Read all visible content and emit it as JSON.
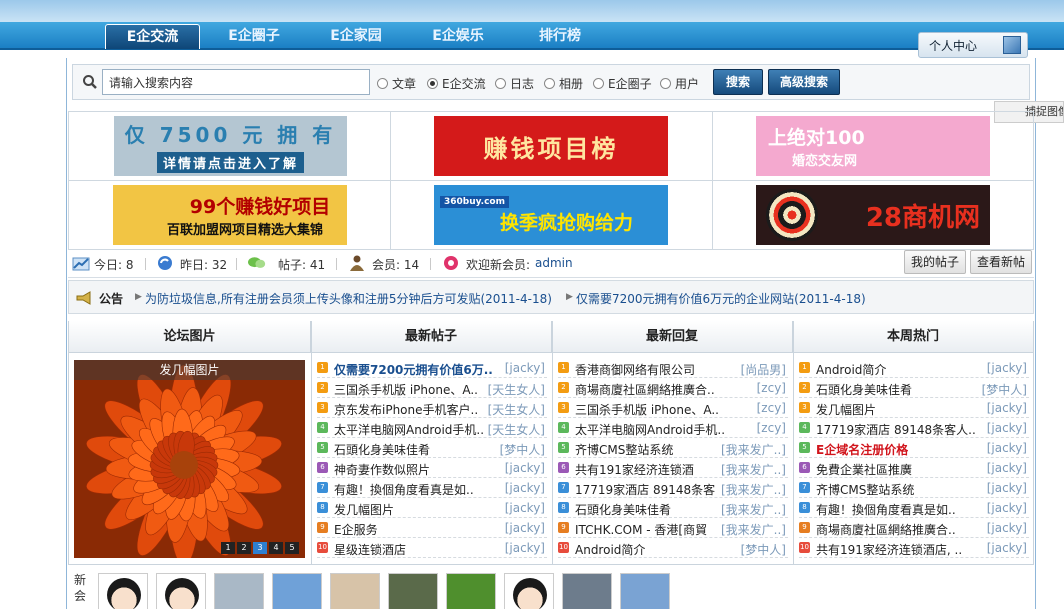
{
  "nav": {
    "tabs": [
      {
        "label": "E企交流",
        "active": true
      },
      {
        "label": "E企圈子",
        "active": false
      },
      {
        "label": "E企家园",
        "active": false
      },
      {
        "label": "E企娱乐",
        "active": false
      },
      {
        "label": "排行榜",
        "active": false
      }
    ],
    "user_center": "个人中心"
  },
  "search": {
    "placeholder": "请输入搜索内容",
    "value": "请输入搜索内容",
    "options": [
      {
        "label": "文章",
        "checked": false
      },
      {
        "label": "E企交流",
        "checked": true
      },
      {
        "label": "日志",
        "checked": false
      },
      {
        "label": "相册",
        "checked": false
      },
      {
        "label": "E企圈子",
        "checked": false
      },
      {
        "label": "用户",
        "checked": false
      }
    ],
    "search_button": "搜索",
    "advanced_button": "高级搜索"
  },
  "capture_popup": "捕捉图像",
  "ads": [
    {
      "line1": "仅 7500 元 拥 有",
      "line2": "详情请点击进入了解",
      "bg": "#b4c6d2",
      "fg": "#2a7fb0"
    },
    {
      "line1": "赚钱项目榜",
      "line2": "",
      "bg": "#d41a1a",
      "fg": "#ffe6a0"
    },
    {
      "line1": "上绝对100",
      "line2": "婚恋交友网",
      "bg": "#f4a9cf",
      "fg": "#fff"
    },
    {
      "line1": "99个赚钱好项目",
      "line2": "百联加盟网项目精选大集锦",
      "bg": "#f2c544",
      "fg": "#b30000"
    },
    {
      "line1": "换季疯抢购给力",
      "line2": "360buy.com",
      "bg": "#2b8fd6",
      "fg": "#ffef3c"
    },
    {
      "line1": "28商机网",
      "line2": "",
      "bg": "#2b1818",
      "fg": "#e8301f"
    }
  ],
  "stats": {
    "today": "今日: 8",
    "yesterday": "昨日: 32",
    "posts": "帖子: 41",
    "members": "会员: 14",
    "welcome": "欢迎新会员:",
    "new_member": "admin",
    "my_posts": "我的帖子",
    "view_new": "查看新帖"
  },
  "notice": {
    "label": "公告",
    "items": [
      "为防垃圾信息,所有注册会员须上传头像和注册5分钟后方可发贴(2011-4-18)",
      "仅需要7200元拥有价值6万元的企业网站(2011-4-18)"
    ]
  },
  "columns": {
    "pics": "论坛图片",
    "latest_posts": "最新帖子",
    "latest_replies": "最新回复",
    "weekly_hot": "本周热门"
  },
  "pic_caption": "发几幅图片",
  "pic_pages": [
    "1",
    "2",
    "3",
    "4",
    "5"
  ],
  "pic_active_page": 3,
  "latest_posts": [
    {
      "title": "仅需要7200元拥有价值6万..",
      "author": "[jacky]",
      "style": "bold-blue"
    },
    {
      "title": "三国杀手机版 iPhone、A..",
      "author": "[天生女人]",
      "style": ""
    },
    {
      "title": "京东发布iPhone手机客户..",
      "author": "[天生女人]",
      "style": ""
    },
    {
      "title": "太平洋电脑网Android手机..",
      "author": "[天生女人]",
      "style": ""
    },
    {
      "title": "石頭化身美味佳肴",
      "author": "[梦中人]",
      "style": ""
    },
    {
      "title": "神奇妻作数似照片",
      "author": "[jacky]",
      "style": ""
    },
    {
      "title": "有趣！換個角度看真是如..",
      "author": "[jacky]",
      "style": ""
    },
    {
      "title": "发几幅图片",
      "author": "[jacky]",
      "style": ""
    },
    {
      "title": "E企服务",
      "author": "[jacky]",
      "style": ""
    },
    {
      "title": "星级连锁酒店",
      "author": "[jacky]",
      "style": ""
    }
  ],
  "latest_replies": [
    {
      "title": "香港商御网络有限公司",
      "author": "[尚品男]"
    },
    {
      "title": "商場商廈社區網絡推廣合..",
      "author": "[zcy]"
    },
    {
      "title": "三国杀手机版 iPhone、A..",
      "author": "[zcy]"
    },
    {
      "title": "太平洋电脑网Android手机..",
      "author": "[zcy]"
    },
    {
      "title": "齐博CMS整站系统",
      "author": "[我来发广..]"
    },
    {
      "title": "共有191家经济连锁酒",
      "author": "[我来发广..]"
    },
    {
      "title": "17719家酒店 89148条客",
      "author": "[我来发广..]"
    },
    {
      "title": "石頭化身美味佳肴",
      "author": "[我来发广..]"
    },
    {
      "title": "ITCHK.COM - 香港[商貿",
      "author": "[我来发广..]"
    },
    {
      "title": "Android简介",
      "author": "[梦中人]"
    }
  ],
  "weekly_hot": [
    {
      "title": "Android简介",
      "author": "[jacky]",
      "style": ""
    },
    {
      "title": "石頭化身美味佳肴",
      "author": "[梦中人]",
      "style": ""
    },
    {
      "title": "发几幅图片",
      "author": "[jacky]",
      "style": ""
    },
    {
      "title": "17719家酒店 89148条客人..",
      "author": "[jacky]",
      "style": ""
    },
    {
      "title": "E企域名注册价格",
      "author": "[jacky]",
      "style": "bold-red"
    },
    {
      "title": "免費企業社區推廣",
      "author": "[jacky]",
      "style": ""
    },
    {
      "title": "齐博CMS整站系统",
      "author": "[jacky]",
      "style": ""
    },
    {
      "title": "有趣！換個角度看真是如..",
      "author": "[jacky]",
      "style": ""
    },
    {
      "title": "商場商廈社區網絡推廣合..",
      "author": "[jacky]",
      "style": ""
    },
    {
      "title": "共有191家经济连锁酒店, ..",
      "author": "[jacky]",
      "style": ""
    }
  ],
  "rank_colors": [
    "#f39c12",
    "#f39c12",
    "#f39c12",
    "#5cb85c",
    "#5cb85c",
    "#9b59b6",
    "#3a8fd8",
    "#3a8fd8",
    "#e67e22",
    "#e74c3c"
  ],
  "new_members_label": "新会"
}
